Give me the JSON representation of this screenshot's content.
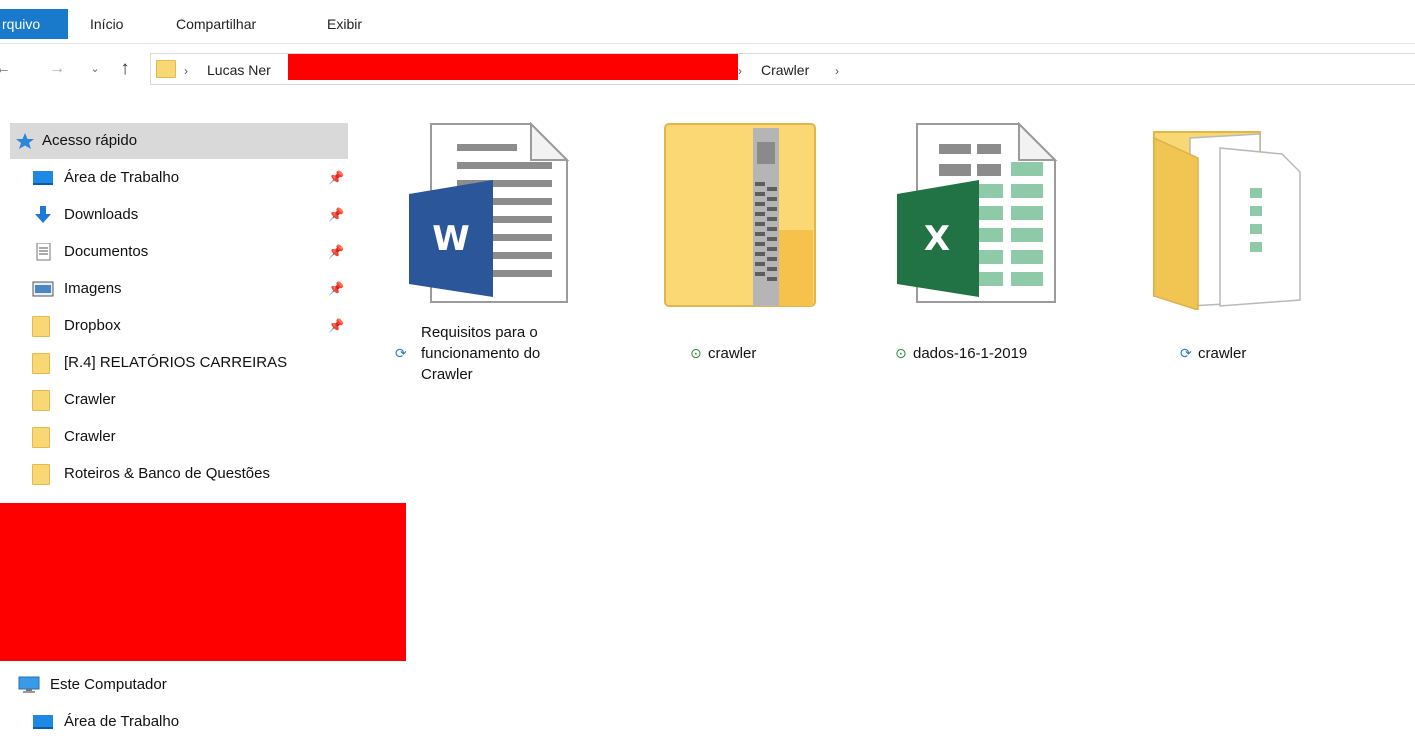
{
  "ribbon": {
    "file_tab": "rquivo",
    "tabs": [
      "Início",
      "Compartilhar",
      "Exibir"
    ]
  },
  "address": {
    "crumbs": [
      "Lucas Ner",
      "Crawler"
    ],
    "separator": "›"
  },
  "sidebar": {
    "quick_access": "Acesso rápido",
    "items": [
      {
        "label": "Área de Trabalho",
        "icon": "desktop-icon",
        "pinned": true
      },
      {
        "label": "Downloads",
        "icon": "download-arrow-icon",
        "pinned": true
      },
      {
        "label": "Documentos",
        "icon": "document-icon",
        "pinned": true
      },
      {
        "label": "Imagens",
        "icon": "pictures-icon",
        "pinned": true
      },
      {
        "label": "Dropbox",
        "icon": "folder-icon",
        "pinned": true
      },
      {
        "label": "[R.4] RELATÓRIOS CARREIRAS",
        "icon": "folder-icon",
        "pinned": false
      },
      {
        "label": "Crawler",
        "icon": "folder-icon",
        "pinned": false
      },
      {
        "label": "Crawler",
        "icon": "folder-icon",
        "pinned": false
      },
      {
        "label": "Roteiros & Banco de Questões",
        "icon": "folder-icon",
        "pinned": false
      }
    ],
    "this_pc": "Este Computador",
    "this_pc_items": [
      {
        "label": "Área de Trabalho",
        "icon": "desktop-icon"
      }
    ]
  },
  "files": [
    {
      "label": "Requisitos para o\nfuncionamento do\nCrawler",
      "type": "word-document-icon",
      "status": "sync"
    },
    {
      "label": "crawler",
      "type": "zip-folder-icon",
      "status": "ok"
    },
    {
      "label": "dados-16-1-2019",
      "type": "excel-spreadsheet-icon",
      "status": "ok"
    },
    {
      "label": "crawler",
      "type": "folder-icon",
      "status": "sync"
    }
  ],
  "colors": {
    "file_tab": "#1979ca",
    "selection": "#d9d9d9",
    "redaction": "#ff0000",
    "folder": "#f8d775",
    "word_blue": "#2b579a",
    "excel_green": "#217346",
    "sync_blue": "#2a7ad5",
    "ok_green": "#2c8c3a"
  }
}
